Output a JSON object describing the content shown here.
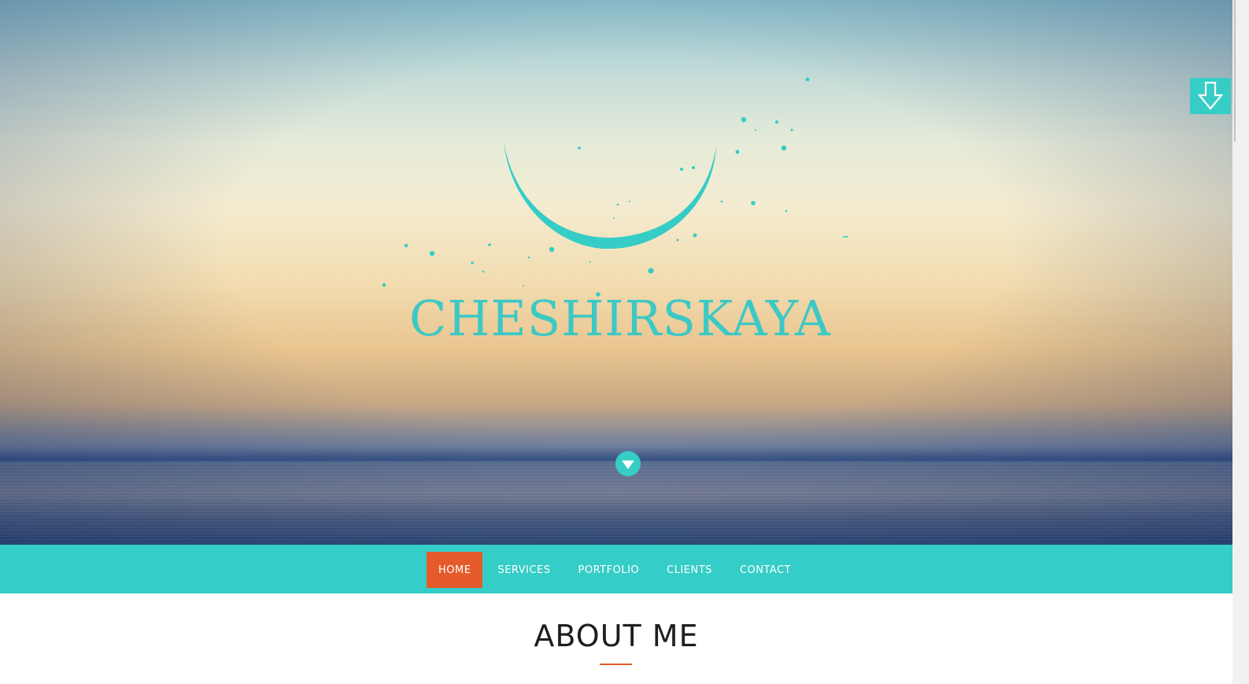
{
  "brand": {
    "name": "CHESHIRSKAYA",
    "accent_color": "#36cdc6",
    "highlight_color": "#e55a2b"
  },
  "hero": {
    "scroll_icon": "chevron-down-icon",
    "side_icon": "arrow-down-icon"
  },
  "nav": {
    "items": [
      {
        "label": "HOME",
        "active": true
      },
      {
        "label": "SERVICES",
        "active": false
      },
      {
        "label": "PORTFOLIO",
        "active": false
      },
      {
        "label": "CLIENTS",
        "active": false
      },
      {
        "label": "CONTACT",
        "active": false
      }
    ]
  },
  "about": {
    "title": "ABOUT ME"
  }
}
